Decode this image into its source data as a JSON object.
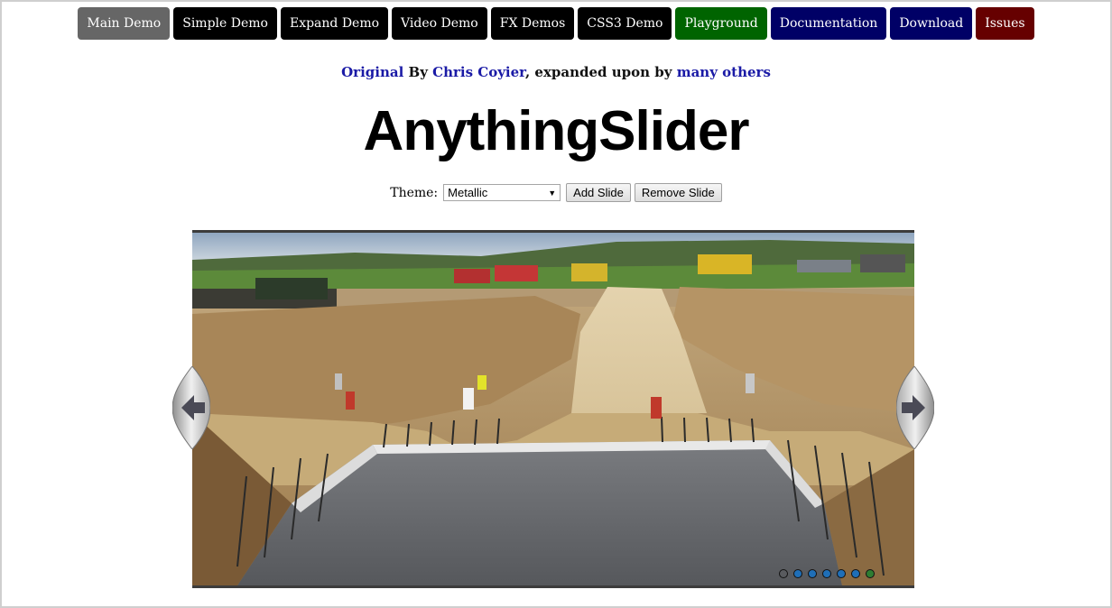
{
  "nav": [
    {
      "label": "Main Demo",
      "color": "#666666"
    },
    {
      "label": "Simple Demo",
      "color": "#000000"
    },
    {
      "label": "Expand Demo",
      "color": "#000000"
    },
    {
      "label": "Video Demo",
      "color": "#000000"
    },
    {
      "label": "FX Demos",
      "color": "#000000"
    },
    {
      "label": "CSS3 Demo",
      "color": "#000000"
    },
    {
      "label": "Playground",
      "color": "#006400"
    },
    {
      "label": "Documentation",
      "color": "#000066"
    },
    {
      "label": "Download",
      "color": "#000066"
    },
    {
      "label": "Issues",
      "color": "#660000"
    }
  ],
  "credit": {
    "original_link": "Original",
    "by": " By ",
    "author_link": "Chris Coyier",
    "expanded": ", expanded upon by ",
    "others_link": "many others"
  },
  "title": "AnythingSlider",
  "controls": {
    "theme_label": "Theme:",
    "theme_value": "Metallic",
    "add_slide": "Add Slide",
    "remove_slide": "Remove Slide"
  },
  "slider": {
    "slide_count": 7,
    "current_slide": 7,
    "dot_colors": {
      "inactive": "#1f6fb8",
      "current": "#2e7d32"
    }
  }
}
